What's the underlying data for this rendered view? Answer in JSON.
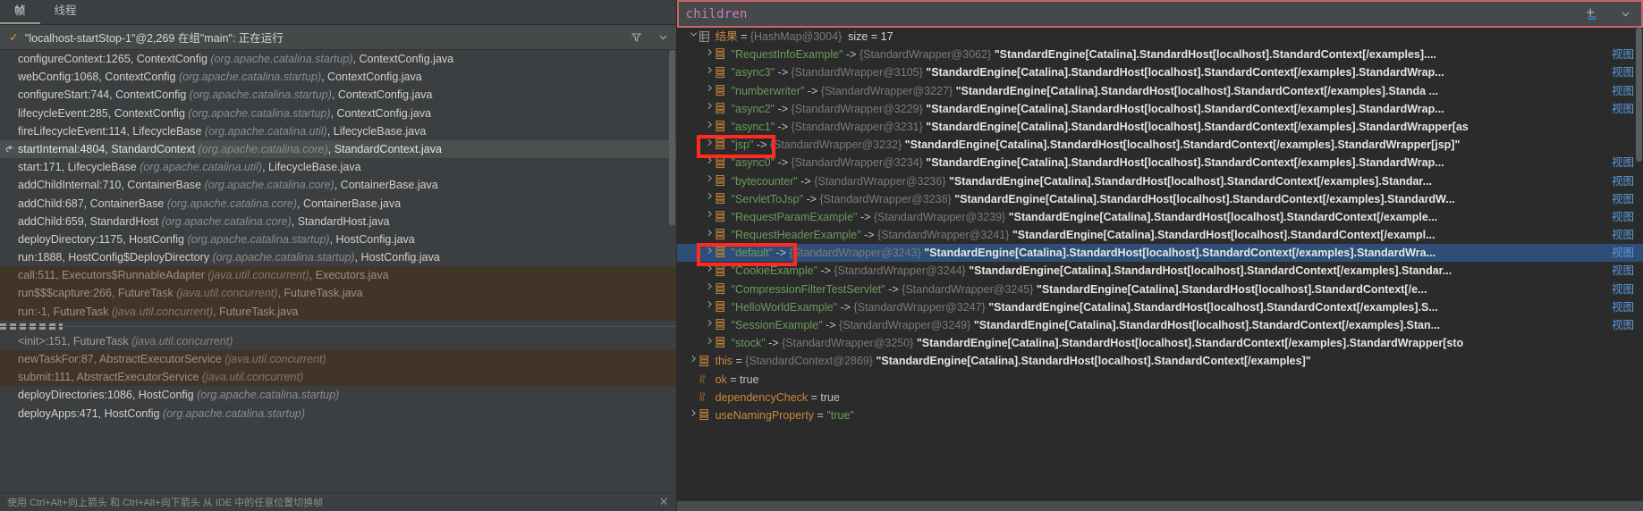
{
  "left_panel": {
    "tabs": [
      {
        "label": "帧",
        "active": true
      },
      {
        "label": "线程",
        "active": false
      }
    ],
    "thread": {
      "status_icon": "check-icon",
      "label": "\"localhost-startStop-1\"@2,269 在组\"main\": 正在运行",
      "filter_icon": "filter-icon",
      "chevron_icon": "chevron-down-icon"
    },
    "frames": [
      {
        "method": "configureContext:1265, ContextConfig ",
        "pkg": "(org.apache.catalina.startup)",
        "file": ", ContextConfig.java",
        "style": "normal"
      },
      {
        "method": "webConfig:1068, ContextConfig ",
        "pkg": "(org.apache.catalina.startup)",
        "file": ", ContextConfig.java",
        "style": "normal"
      },
      {
        "method": "configureStart:744, ContextConfig ",
        "pkg": "(org.apache.catalina.startup)",
        "file": ", ContextConfig.java",
        "style": "normal"
      },
      {
        "method": "lifecycleEvent:285, ContextConfig ",
        "pkg": "(org.apache.catalina.startup)",
        "file": ", ContextConfig.java",
        "style": "normal"
      },
      {
        "method": "fireLifecycleEvent:114, LifecycleBase ",
        "pkg": "(org.apache.catalina.util)",
        "file": ", LifecycleBase.java",
        "style": "normal"
      },
      {
        "method": "startInternal:4804, StandardContext ",
        "pkg": "(org.apache.catalina.core)",
        "file": ", StandardContext.java",
        "style": "current",
        "icon": "return-arrow-icon"
      },
      {
        "method": "start:171, LifecycleBase ",
        "pkg": "(org.apache.catalina.util)",
        "file": ", LifecycleBase.java",
        "style": "normal"
      },
      {
        "method": "addChildInternal:710, ContainerBase ",
        "pkg": "(org.apache.catalina.core)",
        "file": ", ContainerBase.java",
        "style": "normal"
      },
      {
        "method": "addChild:687, ContainerBase ",
        "pkg": "(org.apache.catalina.core)",
        "file": ", ContainerBase.java",
        "style": "normal"
      },
      {
        "method": "addChild:659, StandardHost ",
        "pkg": "(org.apache.catalina.core)",
        "file": ", StandardHost.java",
        "style": "normal"
      },
      {
        "method": "deployDirectory:1175, HostConfig ",
        "pkg": "(org.apache.catalina.startup)",
        "file": ", HostConfig.java",
        "style": "normal"
      },
      {
        "method": "run:1888, HostConfig$DeployDirectory ",
        "pkg": "(org.apache.catalina.startup)",
        "file": ", HostConfig.java",
        "style": "normal"
      },
      {
        "method": "call:511, Executors$RunnableAdapter ",
        "pkg": "(java.util.concurrent)",
        "file": ", Executors.java",
        "style": "lib"
      },
      {
        "method": "run$$$capture:266, FutureTask ",
        "pkg": "(java.util.concurrent)",
        "file": ", FutureTask.java",
        "style": "lib"
      },
      {
        "method": "run:-1, FutureTask ",
        "pkg": "(java.util.concurrent)",
        "file": ", FutureTask.java",
        "style": "lib"
      }
    ],
    "frames_after_separator": [
      {
        "method": "<init>:151, FutureTask ",
        "pkg": "(java.util.concurrent)",
        "file": "",
        "style": "libdim"
      },
      {
        "method": "newTaskFor:87, AbstractExecutorService ",
        "pkg": "(java.util.concurrent)",
        "file": "",
        "style": "lib"
      },
      {
        "method": "submit:111, AbstractExecutorService ",
        "pkg": "(java.util.concurrent)",
        "file": "",
        "style": "lib"
      },
      {
        "method": "deployDirectories:1086, HostConfig ",
        "pkg": "(org.apache.catalina.startup)",
        "file": "",
        "style": "normal"
      },
      {
        "method": "deployApps:471, HostConfig ",
        "pkg": "(org.apache.catalina.startup)",
        "file": "",
        "style": "normal"
      }
    ],
    "status_hint": "使用 Ctrl+Alt+向上箭头 和 Ctrl+Alt+向下箭头 从 IDE 中的任意位置切换帧",
    "close_icon": "close-icon"
  },
  "right_panel": {
    "expression": "children",
    "add_watch_icon": "add-watch-icon",
    "chevron_icon": "chevron-down-icon",
    "view_link_label": "视图",
    "root": {
      "name": "结果",
      "op": "=",
      "ref": "{HashMap@3004}",
      "size_label": "size = 17",
      "icon": "map-icon"
    },
    "entries": [
      {
        "key": "\"RequestInfoExample\"",
        "arrow": "->",
        "ref": "{StandardWrapper@3062}",
        "value": "\"StandardEngine[Catalina].StandardHost[localhost].StandardContext[/examples]....",
        "truncated": true
      },
      {
        "key": "\"async3\"",
        "arrow": "->",
        "ref": "{StandardWrapper@3105}",
        "value": "\"StandardEngine[Catalina].StandardHost[localhost].StandardContext[/examples].StandardWrap...",
        "truncated": true
      },
      {
        "key": "\"numberwriter\"",
        "arrow": "->",
        "ref": "{StandardWrapper@3227}",
        "value": "\"StandardEngine[Catalina].StandardHost[localhost].StandardContext[/examples].Standa ...",
        "truncated": true
      },
      {
        "key": "\"async2\"",
        "arrow": "->",
        "ref": "{StandardWrapper@3229}",
        "value": "\"StandardEngine[Catalina].StandardHost[localhost].StandardContext[/examples].StandardWrap...",
        "truncated": true
      },
      {
        "key": "\"async1\"",
        "arrow": "->",
        "ref": "{StandardWrapper@3231}",
        "value": "\"StandardEngine[Catalina].StandardHost[localhost].StandardContext[/examples].StandardWrapper[as",
        "truncated": false
      },
      {
        "key": "\"jsp\"",
        "arrow": "->",
        "ref": "{StandardWrapper@3232}",
        "value": "\"StandardEngine[Catalina].StandardHost[localhost].StandardContext[/examples].StandardWrapper[jsp]\"",
        "truncated": false,
        "annotated": true
      },
      {
        "key": "\"async0\"",
        "arrow": "->",
        "ref": "{StandardWrapper@3234}",
        "value": "\"StandardEngine[Catalina].StandardHost[localhost].StandardContext[/examples].StandardWrap...",
        "truncated": true
      },
      {
        "key": "\"bytecounter\"",
        "arrow": "->",
        "ref": "{StandardWrapper@3236}",
        "value": "\"StandardEngine[Catalina].StandardHost[localhost].StandardContext[/examples].Standar...",
        "truncated": true
      },
      {
        "key": "\"ServletToJsp\"",
        "arrow": "->",
        "ref": "{StandardWrapper@3238}",
        "value": "\"StandardEngine[Catalina].StandardHost[localhost].StandardContext[/examples].StandardW...",
        "truncated": true
      },
      {
        "key": "\"RequestParamExample\"",
        "arrow": "->",
        "ref": "{StandardWrapper@3239}",
        "value": "\"StandardEngine[Catalina].StandardHost[localhost].StandardContext[/example...",
        "truncated": true
      },
      {
        "key": "\"RequestHeaderExample\"",
        "arrow": "->",
        "ref": "{StandardWrapper@3241}",
        "value": "\"StandardEngine[Catalina].StandardHost[localhost].StandardContext[/exampl...",
        "truncated": true
      },
      {
        "key": "\"default\"",
        "arrow": "->",
        "ref": "{StandardWrapper@3243}",
        "value": "\"StandardEngine[Catalina].StandardHost[localhost].StandardContext[/examples].StandardWra...",
        "truncated": true,
        "selected": true,
        "annotated": true
      },
      {
        "key": "\"CookieExample\"",
        "arrow": "->",
        "ref": "{StandardWrapper@3244}",
        "value": "\"StandardEngine[Catalina].StandardHost[localhost].StandardContext[/examples].Standar...",
        "truncated": true
      },
      {
        "key": "\"CompressionFilterTestServlet\"",
        "arrow": "->",
        "ref": "{StandardWrapper@3245}",
        "value": "\"StandardEngine[Catalina].StandardHost[localhost].StandardContext[/e...",
        "truncated": true
      },
      {
        "key": "\"HelloWorldExample\"",
        "arrow": "->",
        "ref": "{StandardWrapper@3247}",
        "value": "\"StandardEngine[Catalina].StandardHost[localhost].StandardContext[/examples].S...",
        "truncated": true
      },
      {
        "key": "\"SessionExample\"",
        "arrow": "->",
        "ref": "{StandardWrapper@3249}",
        "value": "\"StandardEngine[Catalina].StandardHost[localhost].StandardContext[/examples].Stan...",
        "truncated": true
      },
      {
        "key": "\"stock\"",
        "arrow": "->",
        "ref": "{StandardWrapper@3250}",
        "value": "\"StandardEngine[Catalina].StandardHost[localhost].StandardContext[/examples].StandardWrapper[sto",
        "truncated": false
      }
    ],
    "fields": [
      {
        "name": "this",
        "op": "=",
        "ref": "{StandardContext@2869}",
        "value": "\"StandardEngine[Catalina].StandardHost[localhost].StandardContext[/examples]\"",
        "icon": "object-icon",
        "expandable": true
      },
      {
        "name": "ok",
        "op": "=",
        "value": "true",
        "icon": "boolean-icon",
        "expandable": false
      },
      {
        "name": "dependencyCheck",
        "op": "=",
        "value": "true",
        "icon": "boolean-icon",
        "expandable": false
      },
      {
        "name": "useNamingProperty",
        "op": "=",
        "value": "\"true\"",
        "icon": "object-icon",
        "expandable": true,
        "value_is_string": true
      }
    ]
  },
  "colors": {
    "panel_bg": "#3c3f41",
    "tree_bg": "#2b2b2b",
    "selection": "#2f4e77",
    "library_frame": "#413527",
    "accent_red": "#ff2a22",
    "expr_border": "#c8656a",
    "string_green": "#6a9b5b",
    "field_orange": "#c9883a",
    "link_blue": "#5a9ae0"
  }
}
